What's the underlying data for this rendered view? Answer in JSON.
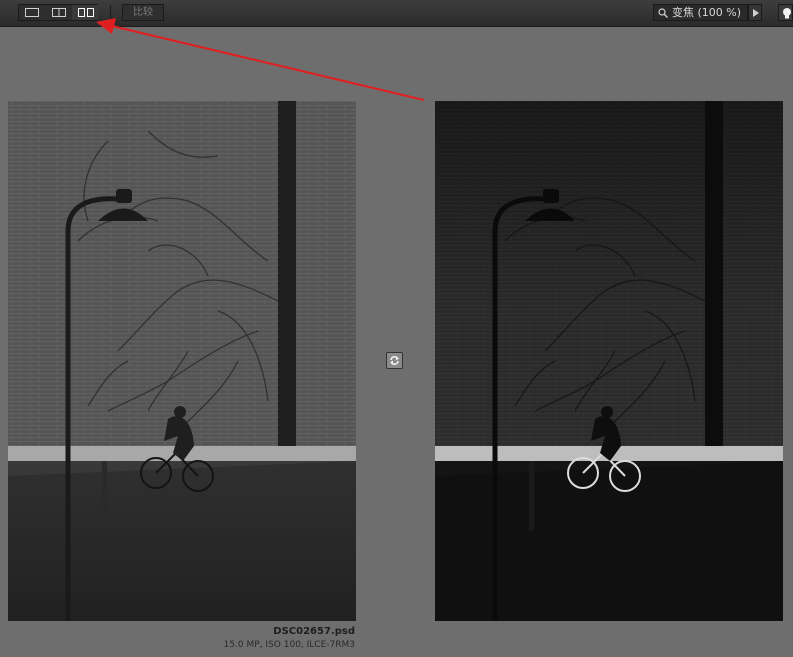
{
  "toolbar": {
    "view_buttons": [
      {
        "icon": "single-view-icon",
        "active": false
      },
      {
        "icon": "split-view-icon",
        "active": false
      },
      {
        "icon": "side-by-side-view-icon",
        "active": true
      }
    ],
    "compare_label": "比较",
    "zoom_label": "变焦 (100 %)",
    "zoom_icon": "magnifier-icon",
    "zoom_dropdown_icon": "triangle-right-icon",
    "lighting_icon": "lightbulb-icon"
  },
  "images": {
    "left": {
      "name": "before-photo",
      "tone": "bright"
    },
    "right": {
      "name": "after-photo",
      "tone": "dark"
    }
  },
  "sync_icon": "sync-refresh-icon",
  "file": {
    "filename": "DSC02657.psd",
    "meta": "15.0 MP, ISO 100, ILCE-7RM3"
  },
  "annotation": {
    "color": "#e02020"
  },
  "colors": {
    "background": "#6e6e6e",
    "toolbar": "#333333"
  }
}
